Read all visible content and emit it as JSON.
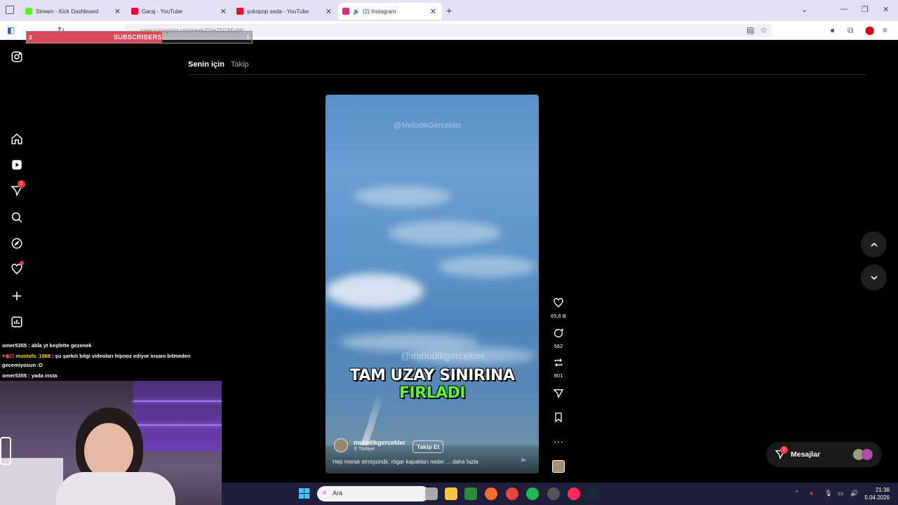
{
  "browser": {
    "tabs": [
      {
        "title": "Stream - Kick Dashboard",
        "favicon_color": "#53fc18",
        "active": false
      },
      {
        "title": "Garaj - YouTube",
        "favicon_color": "#ff0033",
        "active": false
      },
      {
        "title": "şokopop seda - YouTube",
        "favicon_color": "#ff0033",
        "active": false
      },
      {
        "title": "(2) Instagram",
        "favicon_color": "#d62976",
        "active": true
      }
    ],
    "url": "www.instagram.com/reels/DVeZ503iEqM/"
  },
  "subscriber_goal": {
    "count": "3",
    "label": "SUBSCRIBERS",
    "goal": "5",
    "progress": 0.6
  },
  "feed": {
    "tab_for_you": "Senin için",
    "tab_following": "Takip"
  },
  "reel": {
    "watermark_top": "@MelodikGercekler",
    "watermark_mid": "@melodikgercekler",
    "caption_white": "TAM UZAY SINIRINA",
    "caption_green": "FIRLADI",
    "author": "melodikgercekler",
    "location": "Türkiye",
    "follow_label": "Takip Et",
    "description": "Hep merak etmişsindir, rögar kapakları neder ... daha fazla"
  },
  "actions": {
    "likes": "65,6 B",
    "comments": "562",
    "reposts": "801"
  },
  "sidebar": {
    "notifications_badge": "2"
  },
  "messages": {
    "label": "Mesajlar",
    "badge": "2"
  },
  "chat": [
    {
      "user": "omer5355",
      "text": " : abla yt keşfette gezenek",
      "color": "white"
    },
    {
      "user": "mustafa_1068",
      "text": " : şu şarkılı bilgi videoları hipnoz ediyor insanı bitmeden",
      "color": "yellow"
    },
    {
      "user": "",
      "text": "gecemiyosun :D",
      "color": "white"
    },
    {
      "user": "omer5355",
      "text": " : yada insta",
      "color": "white"
    }
  ],
  "taskbar": {
    "search_placeholder": "Ara",
    "time": "21:38",
    "date": "5.04.2026"
  },
  "colors": {
    "instagram_bg": "#000000",
    "taskbar_bg": "#1f1f3a",
    "caption_green": "#55ff2a",
    "badge_red": "#ff3040"
  }
}
